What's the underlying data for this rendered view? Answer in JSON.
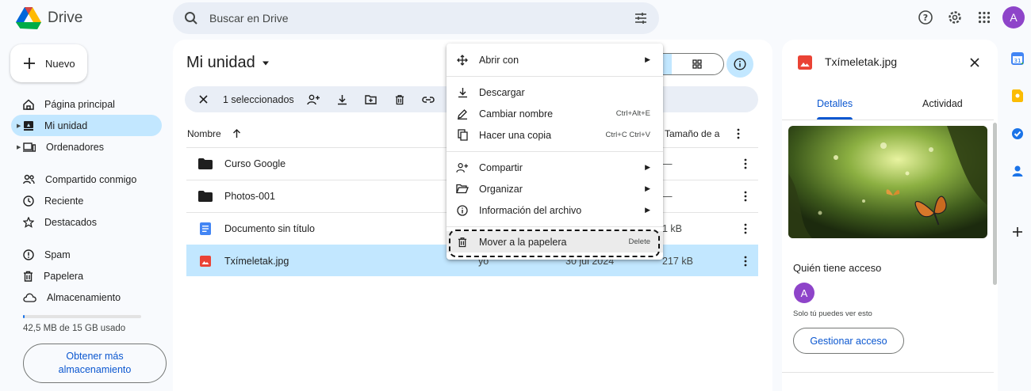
{
  "app": {
    "name": "Drive"
  },
  "search": {
    "placeholder": "Buscar en Drive"
  },
  "sidebar": {
    "new_label": "Nuevo",
    "items": [
      {
        "label": "Página principal"
      },
      {
        "label": "Mi unidad"
      },
      {
        "label": "Ordenadores"
      },
      {
        "label": "Compartido conmigo"
      },
      {
        "label": "Reciente"
      },
      {
        "label": "Destacados"
      },
      {
        "label": "Spam"
      },
      {
        "label": "Papelera"
      },
      {
        "label": "Almacenamiento"
      }
    ],
    "storage_text": "42,5 MB de 15 GB usado",
    "storage_used_fraction": 0.003,
    "get_more": "Obtener más almacenamiento"
  },
  "user": {
    "initial": "A",
    "color": "#8e44c9"
  },
  "main": {
    "title": "Mi unidad",
    "selection_text": "1 seleccionados",
    "columns": {
      "name": "Nombre",
      "size": "Tamaño de a"
    },
    "rows": [
      {
        "name": "Curso Google",
        "owner": "",
        "date": "",
        "size": "—",
        "type": "folder"
      },
      {
        "name": "Photos-001",
        "owner": "",
        "date": "",
        "size": "—",
        "type": "folder"
      },
      {
        "name": "Documento sin título",
        "owner": "",
        "date": "",
        "size": "1 kB",
        "type": "doc"
      },
      {
        "name": "Txímeletak.jpg",
        "owner": "yo",
        "date": "30 jul 2024",
        "size": "217 kB",
        "type": "image",
        "selected": true
      }
    ]
  },
  "context_menu": {
    "items": [
      {
        "label": "Abrir con",
        "shortcut": "",
        "submenu": true
      },
      {
        "label": "Descargar",
        "shortcut": "",
        "submenu": false
      },
      {
        "label": "Cambiar nombre",
        "shortcut": "Ctrl+Alt+E",
        "submenu": false
      },
      {
        "label": "Hacer una copia",
        "shortcut": "Ctrl+C Ctrl+V",
        "submenu": false
      },
      {
        "label": "Compartir",
        "shortcut": "",
        "submenu": true
      },
      {
        "label": "Organizar",
        "shortcut": "",
        "submenu": true
      },
      {
        "label": "Información del archivo",
        "shortcut": "",
        "submenu": true
      },
      {
        "label": "Mover a la papelera",
        "shortcut": "Delete",
        "submenu": false
      }
    ]
  },
  "details": {
    "file_name": "Txímeletak.jpg",
    "tabs": [
      "Detalles",
      "Actividad"
    ],
    "access_heading": "Quién tiene acceso",
    "access_note": "Solo tú puedes ver esto",
    "manage_button": "Gestionar acceso"
  },
  "colors": {
    "accent": "#0b57d0",
    "selected_bg": "#c2e7ff",
    "surface": "#f8fafd",
    "pill_bg": "#e9eef6"
  }
}
